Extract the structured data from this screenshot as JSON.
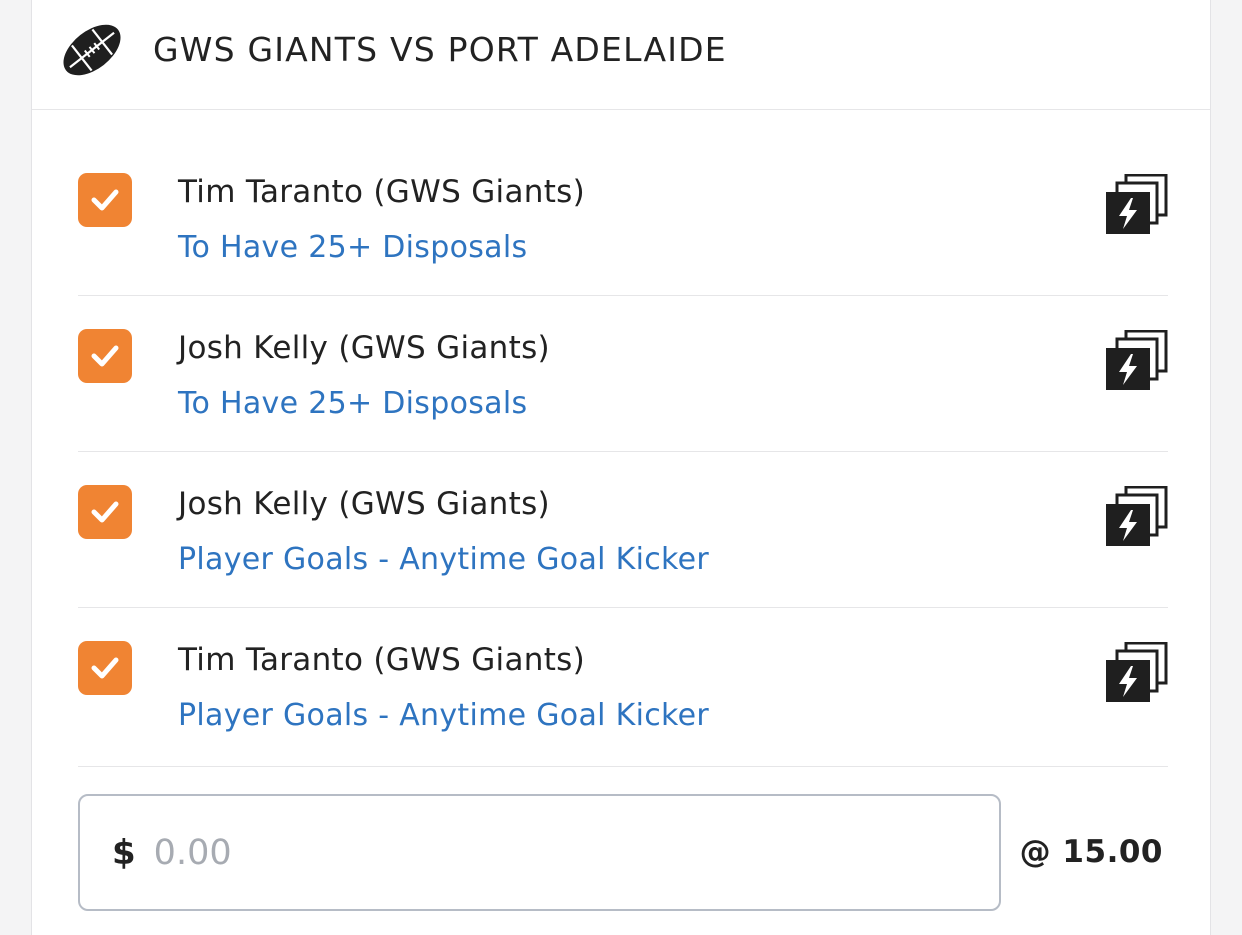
{
  "header": {
    "icon": "football-icon",
    "title": "GWS GIANTS VS PORT ADELAIDE"
  },
  "legs": [
    {
      "player": "Tim Taranto (GWS Giants)",
      "market": "To Have 25+ Disposals",
      "checked": true,
      "icon": "multi-bet-icon"
    },
    {
      "player": "Josh Kelly (GWS Giants)",
      "market": "To Have 25+ Disposals",
      "checked": true,
      "icon": "multi-bet-icon"
    },
    {
      "player": "Josh Kelly (GWS Giants)",
      "market": "Player Goals - Anytime Goal Kicker",
      "checked": true,
      "icon": "multi-bet-icon"
    },
    {
      "player": "Tim Taranto (GWS Giants)",
      "market": "Player Goals - Anytime Goal Kicker",
      "checked": true,
      "icon": "multi-bet-icon"
    }
  ],
  "stake": {
    "currency": "$",
    "placeholder": "0.00",
    "value": ""
  },
  "odds": "@ 15.00",
  "colors": {
    "checkbox": "#f08433",
    "market_text": "#2e74c0",
    "input_border": "#b6bcc6"
  }
}
